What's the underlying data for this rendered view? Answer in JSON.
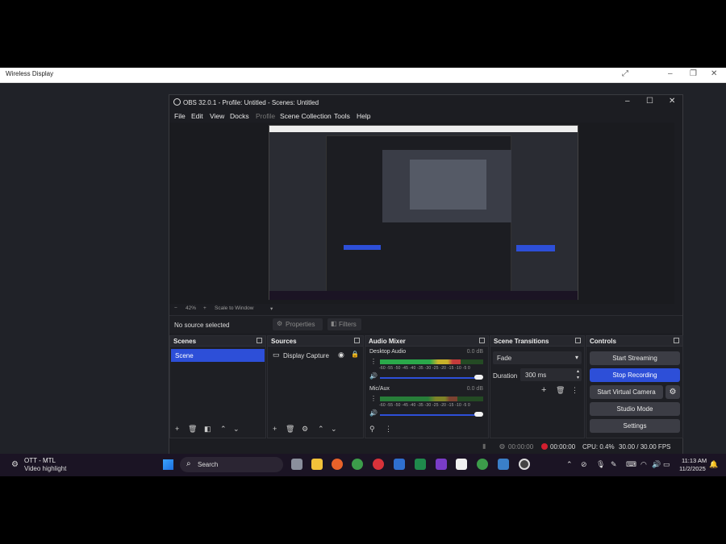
{
  "wireless_display": {
    "title": "Wireless Display"
  },
  "obs": {
    "title": "OBS 32.0.1 - Profile: Untitled - Scenes: Untitled",
    "menu": [
      "File",
      "Edit",
      "View",
      "Docks",
      "Profile",
      "Scene Collection",
      "Tools",
      "Help"
    ],
    "zoom": {
      "minus": "−",
      "value": "42%",
      "plus": "+",
      "mode": "Scale to Window"
    },
    "no_source": "No source selected",
    "properties_label": "Properties",
    "filters_label": "Filters",
    "scenes": {
      "title": "Scenes",
      "items": [
        "Scene"
      ]
    },
    "sources": {
      "title": "Sources",
      "items": [
        "Display Capture"
      ]
    },
    "audio_mixer": {
      "title": "Audio Mixer",
      "channels": [
        {
          "name": "Desktop Audio",
          "db": "0.0 dB",
          "level": 0.78
        },
        {
          "name": "Mic/Aux",
          "db": "0.0 dB",
          "level": 0.75
        }
      ],
      "scale": "-60 -55 -50 -45 -40 -35 -30 -25 -20 -15 -10 -5 0"
    },
    "transitions": {
      "title": "Scene Transitions",
      "type": "Fade",
      "duration_label": "Duration",
      "duration_value": "300 ms"
    },
    "controls": {
      "title": "Controls",
      "start_streaming": "Start Streaming",
      "stop_recording": "Stop Recording",
      "start_virtual_camera": "Start Virtual Camera",
      "studio_mode": "Studio Mode",
      "settings": "Settings"
    },
    "status": {
      "stream_time": "00:00:00",
      "record_time": "00:00:00",
      "cpu": "CPU: 0.4%",
      "fps": "30.00 / 30.00 FPS"
    }
  },
  "taskbar": {
    "weather_title": "OTT - MTL",
    "weather_sub": "Video highlight",
    "search_placeholder": "Search",
    "time": "11:13 AM",
    "date": "11/2/2025"
  },
  "colors": {
    "accent": "#2d4fd8",
    "record": "#d21f2f",
    "bg": "#1e1f24"
  }
}
